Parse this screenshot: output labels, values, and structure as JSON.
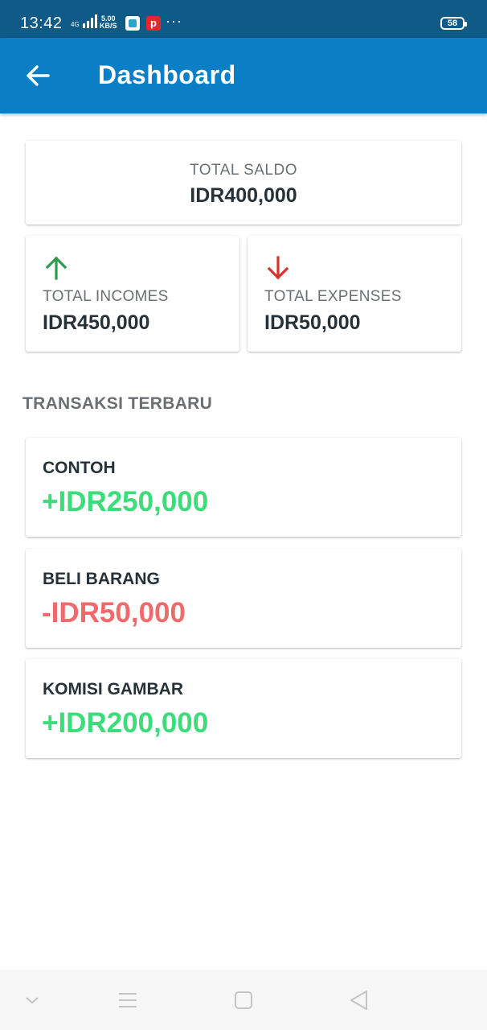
{
  "status_bar": {
    "time": "13:42",
    "network_type": "4G",
    "data_speed_value": "5.00",
    "data_speed_unit": "KB/S",
    "app_icon_2_letter": "p",
    "more_indicator": "···",
    "battery_level": "58"
  },
  "app_bar": {
    "title": "Dashboard"
  },
  "summary": {
    "saldo_label": "TOTAL SALDO",
    "saldo_value": "IDR400,000",
    "incomes_label": "TOTAL INCOMES",
    "incomes_value": "IDR450,000",
    "expenses_label": "TOTAL EXPENSES",
    "expenses_value": "IDR50,000"
  },
  "colors": {
    "primary": "#0b7fc6",
    "status_bar": "#0f5a87",
    "income": "#3ddc7a",
    "expense": "#ef6b6b",
    "income_arrow": "#2e9b4c",
    "expense_arrow": "#d3342f"
  },
  "recent": {
    "title": "TRANSAKSI TERBARU",
    "items": [
      {
        "name": "CONTOH",
        "amount": "+IDR250,000",
        "type": "income"
      },
      {
        "name": "BELI BARANG",
        "amount": "-IDR50,000",
        "type": "expense"
      },
      {
        "name": "KOMISI GAMBAR",
        "amount": "+IDR200,000",
        "type": "income"
      }
    ]
  },
  "nav_bar": {
    "icons": [
      "chevron-down-icon",
      "menu-icon",
      "home-square-icon",
      "back-triangle-icon"
    ]
  }
}
